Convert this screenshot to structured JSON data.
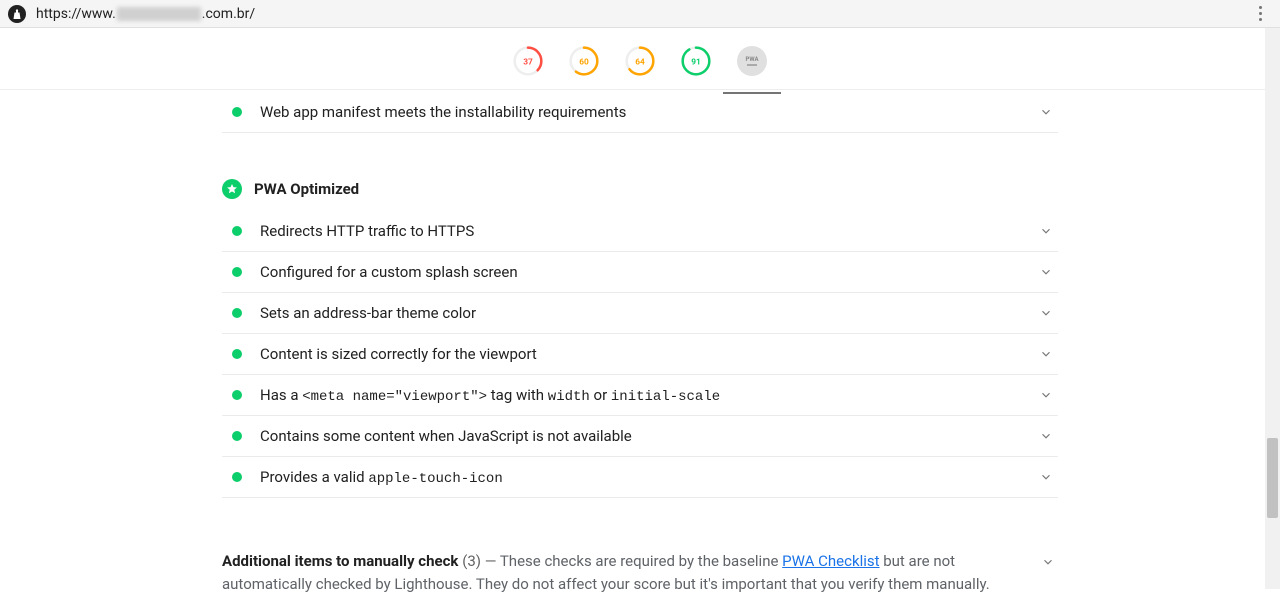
{
  "header": {
    "url_prefix": "https://www.",
    "url_suffix": ".com.br/"
  },
  "scores": [
    {
      "value": 37,
      "color": "#ff4e42",
      "fraction": 0.37,
      "active": false
    },
    {
      "value": 60,
      "color": "#ffa400",
      "fraction": 0.6,
      "active": false
    },
    {
      "value": 64,
      "color": "#ffa400",
      "fraction": 0.64,
      "active": false
    },
    {
      "value": 91,
      "color": "#0cce6b",
      "fraction": 0.91,
      "active": false
    }
  ],
  "pwa_gauge_label": "PWA",
  "top_audit": {
    "title": "Web app manifest meets the installability requirements"
  },
  "section": {
    "title": "PWA Optimized",
    "audits": [
      {
        "plain": "Redirects HTTP traffic to HTTPS"
      },
      {
        "plain": "Configured for a custom splash screen"
      },
      {
        "plain": "Sets an address-bar theme color"
      },
      {
        "plain": "Content is sized correctly for the viewport"
      },
      {
        "pre": "Has a ",
        "code1": "<meta name=\"viewport\">",
        "mid": " tag with ",
        "code2": "width",
        "mid2": " or ",
        "code3": "initial-scale"
      },
      {
        "plain": "Contains some content when JavaScript is not available"
      },
      {
        "pre": "Provides a valid ",
        "code1": "apple-touch-icon"
      }
    ]
  },
  "manual": {
    "heading": "Additional items to manually check",
    "count": "(3)",
    "dash": " — ",
    "desc_pre": "These checks are required by the baseline ",
    "link_text": "PWA Checklist",
    "desc_post": " but are not automatically checked by Lighthouse. They do not affect your score but it's important that you verify them manually."
  }
}
